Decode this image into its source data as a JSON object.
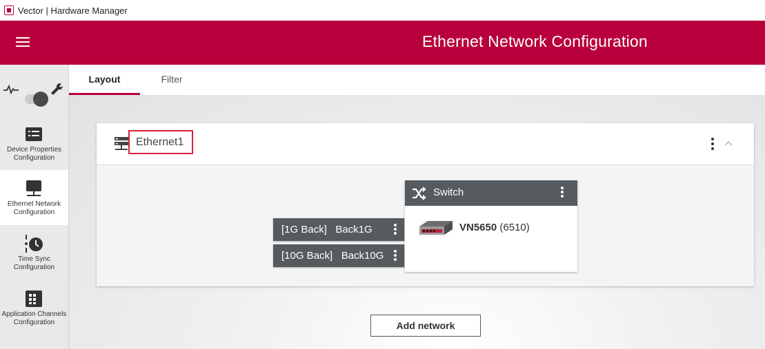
{
  "window": {
    "title": "Vector | Hardware Manager"
  },
  "header": {
    "title": "Ethernet Network Configuration"
  },
  "sidebar": {
    "items": [
      {
        "label": "Device Properties Configuration",
        "icon": "device-properties-icon"
      },
      {
        "label": "Ethernet Network Configuration",
        "icon": "ethernet-network-icon",
        "active": true
      },
      {
        "label": "Time Sync Configuration",
        "icon": "time-sync-icon"
      },
      {
        "label": "Application Channels Configuration",
        "icon": "application-channels-icon"
      }
    ]
  },
  "tabs": [
    {
      "label": "Layout",
      "active": true
    },
    {
      "label": "Filter",
      "active": false
    }
  ],
  "network": {
    "name": "Ethernet1",
    "switch": {
      "title": "Switch",
      "device_model": "VN5650",
      "device_serial": "(6510)"
    },
    "ports": [
      {
        "label": "[1G Back]   Back1G"
      },
      {
        "label": "[10G Back]   Back10G"
      }
    ]
  },
  "actions": {
    "add_network": "Add network"
  },
  "colors": {
    "brand": "#b8003c",
    "dark_panel": "#555b5e",
    "highlight_border": "#d8203a"
  }
}
